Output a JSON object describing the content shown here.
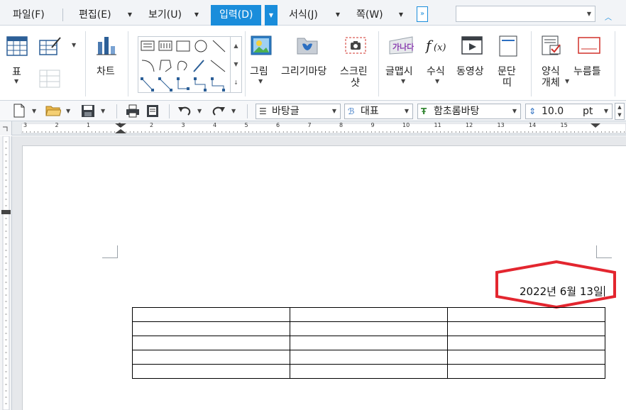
{
  "menu": {
    "tabs": [
      {
        "label": "파일(F)"
      },
      {
        "label": "편집(E)"
      },
      {
        "label": "보기(U)"
      },
      {
        "label": "입력(D)"
      },
      {
        "label": "서식(J)"
      },
      {
        "label": "쪽(W)"
      }
    ],
    "expand_symbol": "»"
  },
  "ribbon": {
    "table_label": "표",
    "chart_label": "차트",
    "picture_label": "그림",
    "drawing_market_label": "그리기마당",
    "screenshot_label_1": "스크린",
    "screenshot_label_2": "샷",
    "wordart_label": "글맵시",
    "equation_label": "수식",
    "video_label": "동영상",
    "paragraph_band_label_1": "문단",
    "paragraph_band_label_2": "띠",
    "form_object_label_1": "양식",
    "form_object_label_2": "개체",
    "push_button_label": "누름틀"
  },
  "toolbar": {
    "style_combo": "바탕글",
    "language_combo": "대표",
    "font_combo": "함초롬바탕",
    "font_size": "10.0",
    "font_unit": "pt"
  },
  "ruler": {
    "numbers": [
      "3",
      "2",
      "1",
      "1",
      "2",
      "3",
      "4",
      "5",
      "6",
      "7",
      "8",
      "9",
      "10",
      "11",
      "12",
      "13",
      "14",
      "15"
    ]
  },
  "document": {
    "date_text": "2022년 6월 13일",
    "table": {
      "rows": 5,
      "cols": 3
    },
    "highlight_color": "#e3262f"
  },
  "colors": {
    "accent": "#1a8ddb",
    "highlight": "#e3262f"
  }
}
